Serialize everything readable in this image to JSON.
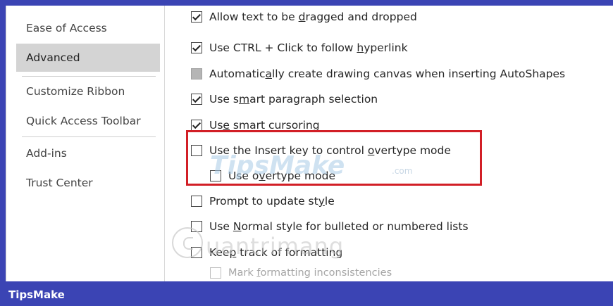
{
  "sidebar": {
    "items": [
      {
        "label": "Ease of Access"
      },
      {
        "label": "Advanced"
      },
      {
        "label": "Customize Ribbon"
      },
      {
        "label": "Quick Access Toolbar"
      },
      {
        "label": "Add-ins"
      },
      {
        "label": "Trust Center"
      }
    ],
    "selected": "Advanced"
  },
  "options": [
    {
      "pre": "Allow text to be ",
      "u": "d",
      "post": "ragged and dropped",
      "state": "checked"
    },
    {
      "pre": "Use CTRL + Click to follow ",
      "u": "h",
      "post": "yperlink",
      "state": "checked"
    },
    {
      "pre": "Automatic",
      "u": "a",
      "post": "lly create drawing canvas when inserting AutoShapes",
      "state": "indeterminate"
    },
    {
      "pre": "Use s",
      "u": "m",
      "post": "art paragraph selection",
      "state": "checked"
    },
    {
      "pre": "Us",
      "u": "e",
      "post": " smart cursoring",
      "state": "checked"
    },
    {
      "pre": "Use the Insert key to control ",
      "u": "o",
      "post": "vertype mode",
      "state": "unchecked"
    },
    {
      "pre": "Use o",
      "u": "v",
      "post": "ertype mode",
      "state": "unchecked"
    },
    {
      "pre": "Prompt to update st",
      "u": "y",
      "post": "le",
      "state": "unchecked"
    },
    {
      "pre": "Use ",
      "u": "N",
      "post": "ormal style for bulleted or numbered lists",
      "state": "unchecked"
    },
    {
      "pre": "Kee",
      "u": "p",
      "post": " track of formatting",
      "state": "unchecked"
    },
    {
      "pre": "Mark ",
      "u": "f",
      "post": "ormatting inconsistencies",
      "state": "disabled"
    }
  ],
  "watermarks": {
    "tipsmake": "TipsMake",
    "tipsmake_suffix": ".com",
    "quantrimang": "uantrimang"
  },
  "footer": {
    "label": "TipsMake"
  },
  "colors": {
    "accent": "#3b44b4",
    "highlight_border": "#d21f26",
    "selected_nav": "#d4d4d4"
  }
}
